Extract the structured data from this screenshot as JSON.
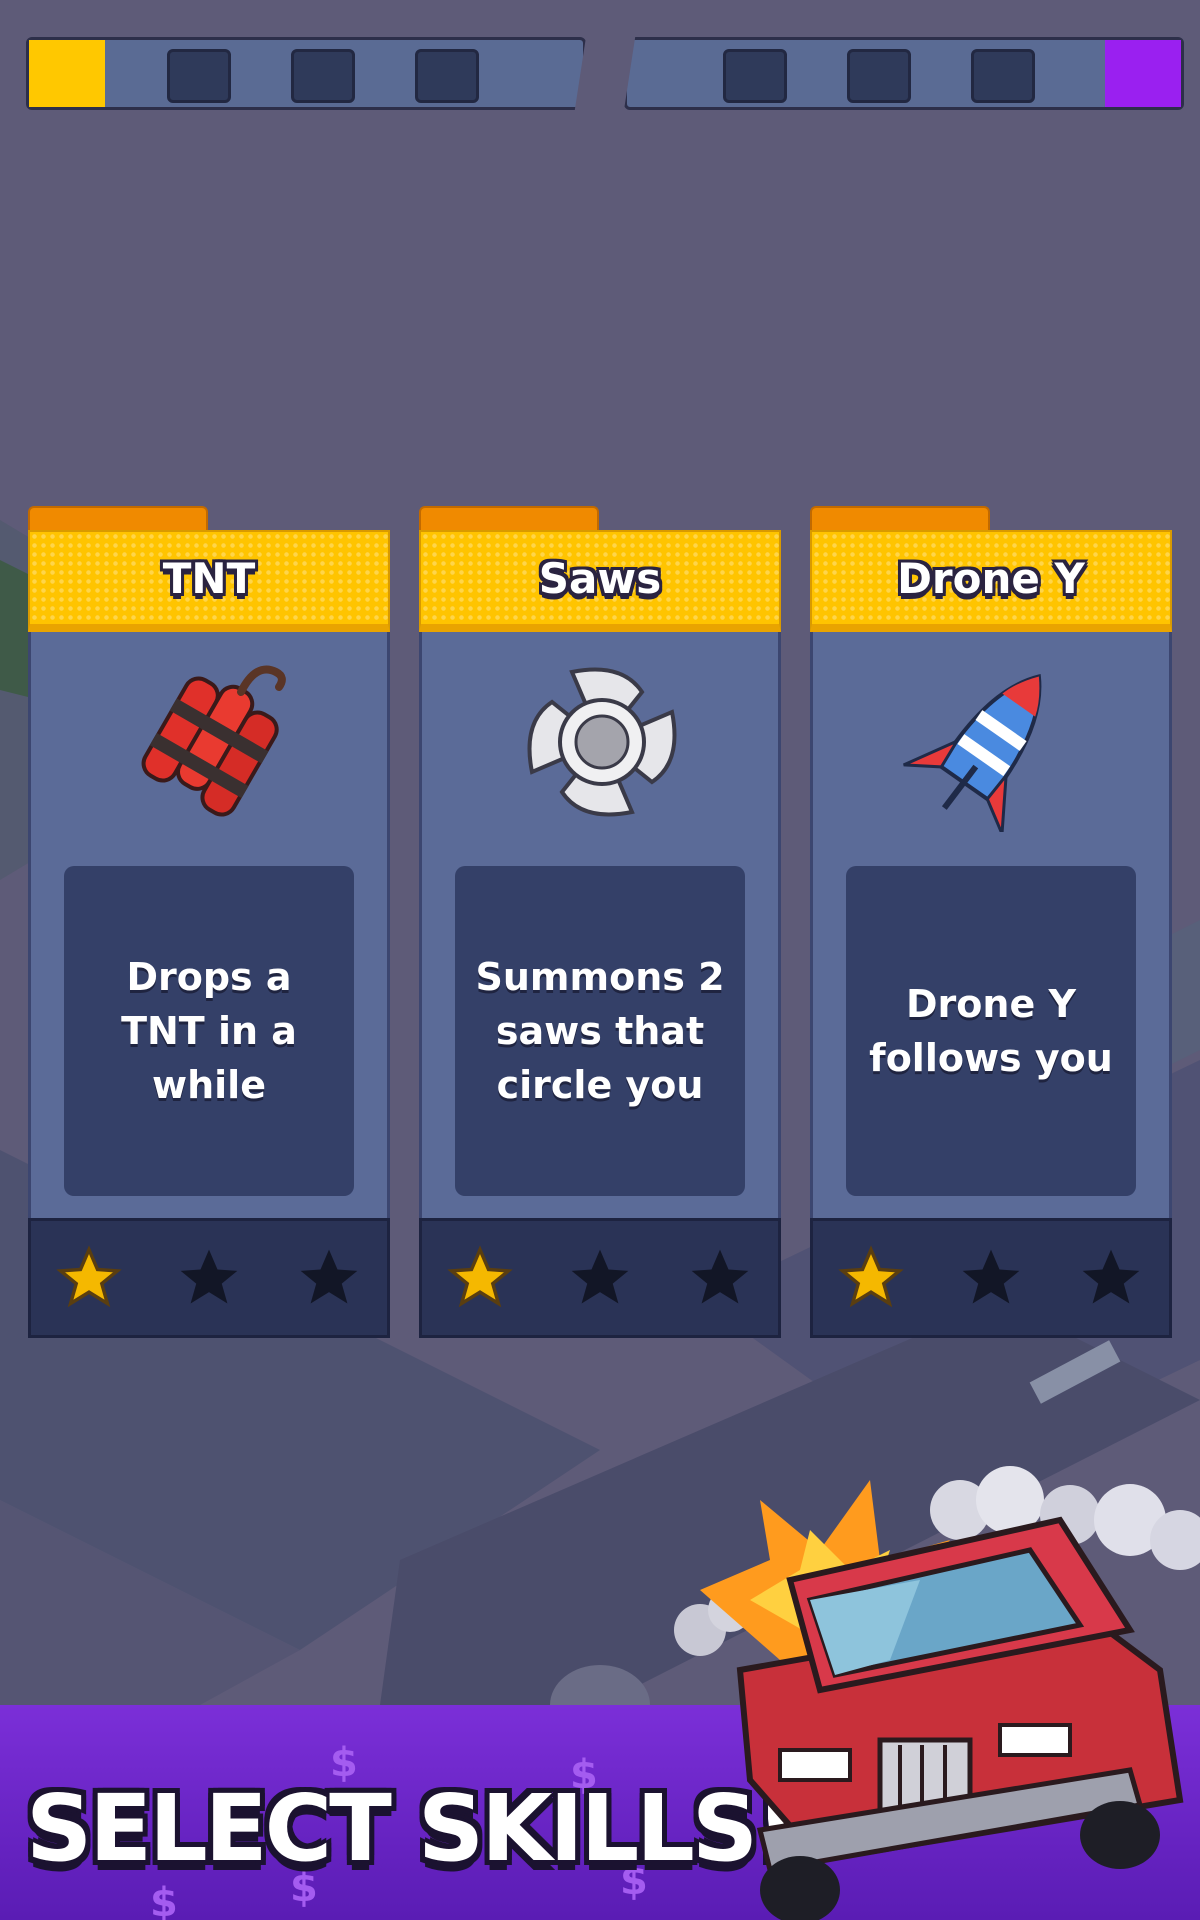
{
  "progress": {
    "left_slots_filled": 1,
    "right_slots_filled": 1,
    "left_color": "#ffc800",
    "right_color": "#9a20f0"
  },
  "cards": [
    {
      "title": "TNT",
      "description": "Drops a TNT in a while",
      "icon": "tnt-icon",
      "stars_filled": 1,
      "stars_total": 3
    },
    {
      "title": "Saws",
      "description": "Summons 2 saws that circle you",
      "icon": "saw-blade-icon",
      "stars_filled": 1,
      "stars_total": 3
    },
    {
      "title": "Drone Y",
      "description": "Drone Y follows you",
      "icon": "rocket-drone-icon",
      "stars_filled": 1,
      "stars_total": 3
    }
  ],
  "banner": {
    "title": "SELECT SKILLS!",
    "decor_icon": "dollar-sign-icon",
    "vehicle_icon": "red-truck-icon"
  },
  "colors": {
    "accent_yellow": "#ffc400",
    "accent_purple": "#7b2fd8",
    "card_body": "#5b6b98"
  }
}
